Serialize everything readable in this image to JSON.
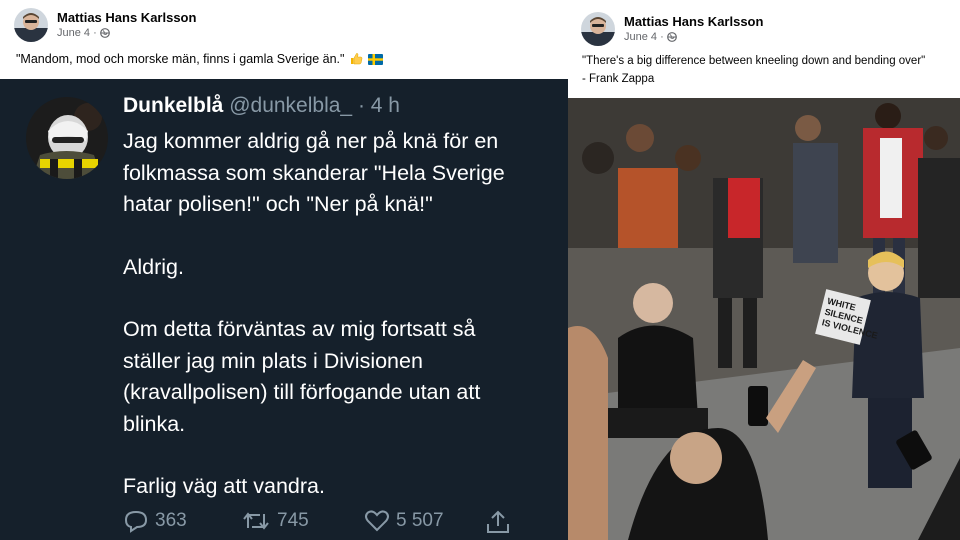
{
  "left_post": {
    "author": "Mattias Hans Karlsson",
    "date": "June 4 ·",
    "text": "\"Mandom, mod och morske män, finns i gamla Sverige än.\"",
    "emojis": [
      "thumbs-up",
      "swedish-flag"
    ]
  },
  "tweet": {
    "display_name": "Dunkelblå",
    "handle": "@dunkelbla_ · 4 h",
    "paragraphs": [
      "Jag kommer aldrig gå ner på knä för en\nfolkmassa som skanderar \"Hela Sverige\nhatar polisen!\" och \"Ner på knä!\"",
      "Aldrig.",
      "Om detta förväntas av mig fortsatt så\nställer jag min plats i Divisionen\n(kravallpolisen) till förfogande utan att\nblinka.",
      "Farlig väg att vandra."
    ],
    "replies": "363",
    "retweets": "745",
    "likes": "5 507",
    "colors": {
      "background": "#15202b",
      "text": "#ffffff",
      "muted": "#8899a6"
    }
  },
  "right_post": {
    "author": "Mattias Hans Karlsson",
    "date": "June 4 ·",
    "quote": "\"There's a big difference between kneeling down and bending over\"",
    "attribution": "- Frank Zappa",
    "photo_sign": "WHITE\nSILENCE\nIS VIOLENCE"
  }
}
